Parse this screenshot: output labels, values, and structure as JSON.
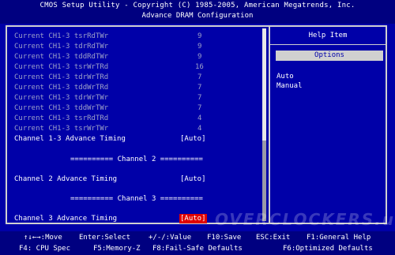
{
  "header": {
    "line1": "CMOS Setup Utility - Copyright (C) 1985-2005, American Megatrends, Inc.",
    "line2": "Advance DRAM Configuration"
  },
  "settings": [
    {
      "label": "Current CH1-3 tsrRdTWr",
      "value": "9"
    },
    {
      "label": "Current CH1-3 tdrRdTWr",
      "value": "9"
    },
    {
      "label": "Current CH1-3 tddRdTWr",
      "value": "9"
    },
    {
      "label": "Current CH1-3 tsrWrTRd",
      "value": "16"
    },
    {
      "label": "Current CH1-3 tdrWrTRd",
      "value": "7"
    },
    {
      "label": "Current CH1-3 tddWrTRd",
      "value": "7"
    },
    {
      "label": "Current CH1-3 tdrWrTWr",
      "value": "7"
    },
    {
      "label": "Current CH1-3 tddWrTWr",
      "value": "7"
    },
    {
      "label": "Current CH1-3 tsrRdTRd",
      "value": "4"
    },
    {
      "label": "Current CH1-3 tsrWrTWr",
      "value": "4"
    }
  ],
  "ch13_timing": {
    "label": "Channel 1-3 Advance Timing",
    "value": "[Auto]"
  },
  "section_ch2": "========== Channel 2 ==========",
  "ch2_timing": {
    "label": "Channel 2 Advance Timing",
    "value": "[Auto]"
  },
  "section_ch3": "========== Channel 3 ==========",
  "ch3_timing": {
    "label": "Channel 3 Advance Timing",
    "value": "[Auto]"
  },
  "help": {
    "title": "Help Item",
    "options_label": "Options",
    "options": [
      "Auto",
      "Manual"
    ]
  },
  "footer": {
    "move": "↑↓←→:Move",
    "enter": "Enter:Select",
    "value": "+/-/:Value",
    "save": "F10:Save",
    "exit": "ESC:Exit",
    "help": "F1:General Help",
    "cpu": "F4: CPU Spec",
    "memory": "F5:Memory-Z",
    "failsafe": "F8:Fail-Safe Defaults",
    "optimized": "F6:Optimized Defaults"
  },
  "watermark": "OVERCLOCKERS.ua"
}
